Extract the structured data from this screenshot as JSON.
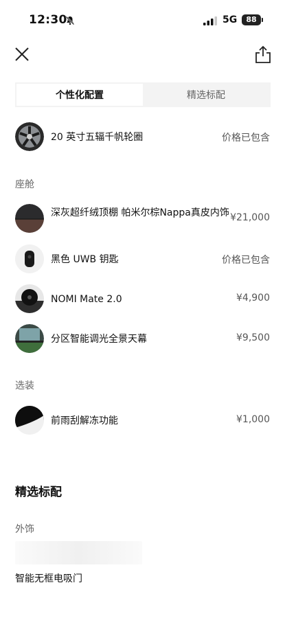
{
  "status_bar": {
    "time": "12:30",
    "network": "5G",
    "battery": "88"
  },
  "tabs": [
    {
      "label": "个性化配置",
      "active": true
    },
    {
      "label": "精选标配",
      "active": false
    }
  ],
  "wheel": {
    "name": "20 英寸五辐千帆轮圈",
    "price": "价格已包含"
  },
  "cabin": {
    "title": "座舱",
    "items": [
      {
        "name": "深灰超纤绒顶棚 帕米尔棕Nappa真皮内饰",
        "price": "¥21,000"
      },
      {
        "name": "黑色 UWB 钥匙",
        "price": "价格已包含"
      },
      {
        "name": "NOMI Mate 2.0",
        "price": "¥4,900"
      },
      {
        "name": "分区智能调光全景天幕",
        "price": "¥9,500"
      }
    ]
  },
  "options": {
    "title": "选装",
    "items": [
      {
        "name": "前雨刮解冻功能",
        "price": "¥1,000"
      }
    ]
  },
  "standard": {
    "title": "精选标配",
    "exterior_title": "外饰",
    "exterior_item": "智能无框电吸门"
  }
}
